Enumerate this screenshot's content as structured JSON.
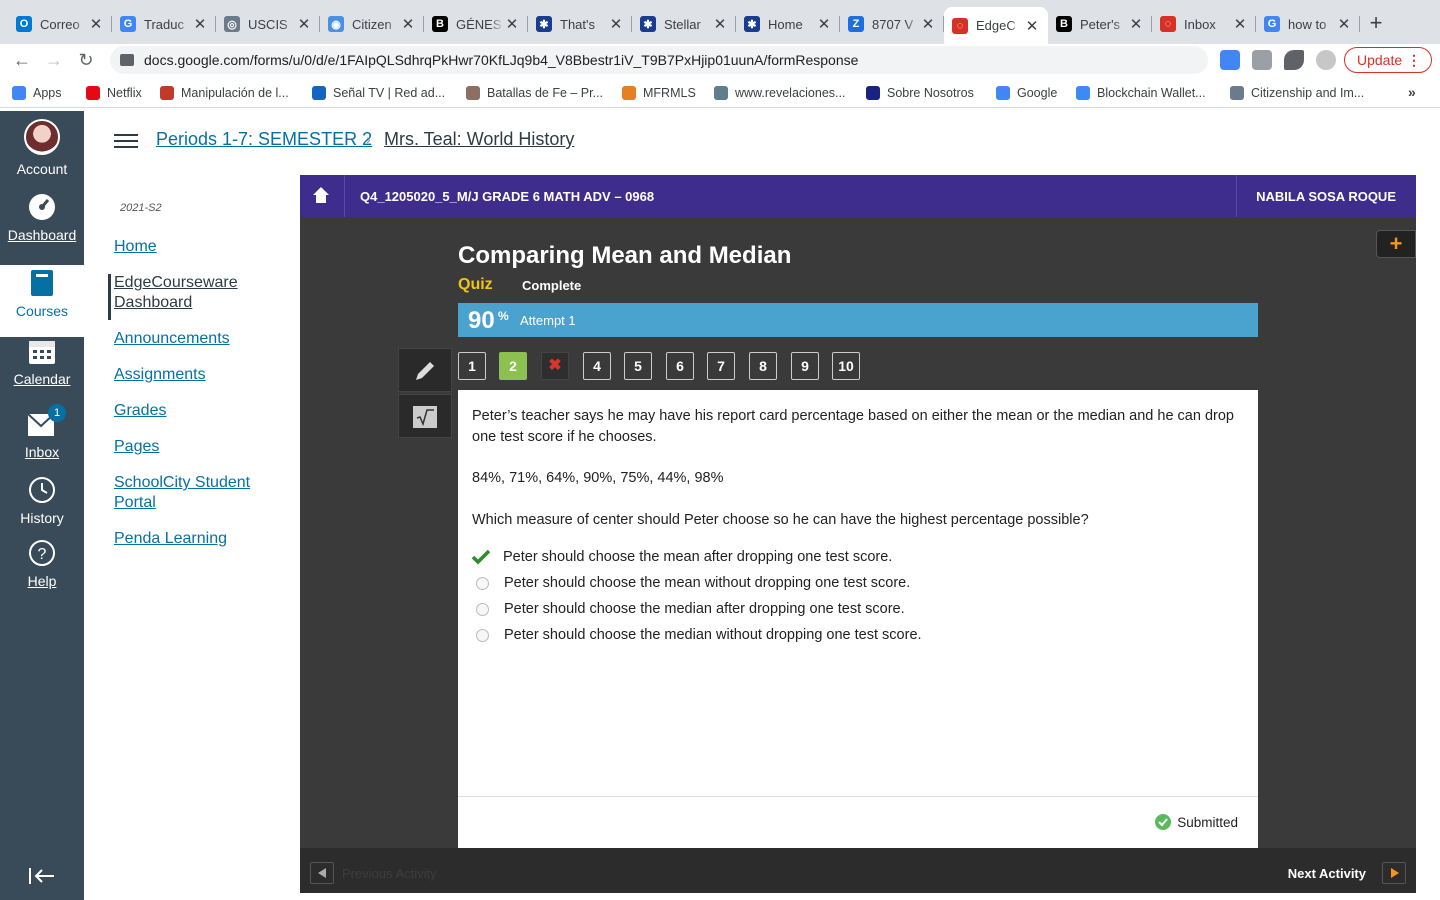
{
  "browser": {
    "tabs": [
      {
        "title": "Correo",
        "color": "#0078d4",
        "glyph": "O"
      },
      {
        "title": "Traduc",
        "color": "#4285f4",
        "glyph": "G"
      },
      {
        "title": "USCIS",
        "color": "#6b7b8c",
        "glyph": "◎"
      },
      {
        "title": "Citizen",
        "color": "#4a90e2",
        "glyph": "◉"
      },
      {
        "title": "GÉNES",
        "color": "#000000",
        "glyph": "B"
      },
      {
        "title": "That's",
        "color": "#1a3c8f",
        "glyph": "✱"
      },
      {
        "title": "Stellar",
        "color": "#1a3c8f",
        "glyph": "✱"
      },
      {
        "title": "Home",
        "color": "#1a3c8f",
        "glyph": "✱"
      },
      {
        "title": "8707 V",
        "color": "#1e6fd9",
        "glyph": "Z"
      },
      {
        "title": "EdgeC",
        "color": "#d93025",
        "glyph": "◌"
      },
      {
        "title": "Peter's",
        "color": "#000000",
        "glyph": "B"
      },
      {
        "title": "Inbox",
        "color": "#d93025",
        "glyph": "◌"
      },
      {
        "title": "how to",
        "color": "#4285f4",
        "glyph": "G"
      }
    ],
    "active_tab_index": 9,
    "url": "docs.google.com/forms/u/0/d/e/1FAIpQLSdhrqPkHwr70KfLJq9b4_V8Bbestr1iV_T9B7PxHjip01uunA/formResponse",
    "update_label": "Update",
    "bookmarks": [
      {
        "label": "Apps",
        "color": "#4285f4"
      },
      {
        "label": "Netflix",
        "color": "#e50914"
      },
      {
        "label": "Manipulación de l...",
        "color": "#c0392b"
      },
      {
        "label": "Señal TV | Red ad...",
        "color": "#1565c0"
      },
      {
        "label": "Batallas de Fe – Pr...",
        "color": "#8d6e63"
      },
      {
        "label": "MFRMLS",
        "color": "#e67e22"
      },
      {
        "label": "www.revelaciones...",
        "color": "#607d8b"
      },
      {
        "label": "Sobre Nosotros",
        "color": "#1a237e"
      },
      {
        "label": "Google",
        "color": "#4285f4"
      },
      {
        "label": "Blockchain Wallet...",
        "color": "#3d89f5"
      },
      {
        "label": "Citizenship and Im...",
        "color": "#6b7b8c"
      }
    ]
  },
  "global_nav": {
    "items": [
      {
        "label": "Account",
        "icon": "avatar"
      },
      {
        "label": "Dashboard",
        "icon": "dashboard-icon"
      },
      {
        "label": "Courses",
        "icon": "courses-icon"
      },
      {
        "label": "Calendar",
        "icon": "calendar-icon"
      },
      {
        "label": "Inbox",
        "icon": "inbox-icon",
        "badge": "1"
      },
      {
        "label": "History",
        "icon": "history-icon"
      },
      {
        "label": "Help",
        "icon": "help-icon"
      }
    ]
  },
  "breadcrumb": {
    "course": "Periods 1-7: SEMESTER 2",
    "page": "Mrs. Teal: World History"
  },
  "course_nav": {
    "term": "2021-S2",
    "items": [
      "Home",
      "EdgeCourseware Dashboard",
      "Announcements",
      "Assignments",
      "Grades",
      "Pages",
      "SchoolCity Student Portal",
      "Penda Learning"
    ]
  },
  "edgenuity": {
    "course_code": "Q4_1205020_5_M/J GRADE 6 MATH ADV – 0968",
    "student_name": "NABILA SOSA ROQUE",
    "lesson_title": "Comparing Mean and Median",
    "activity_type": "Quiz",
    "status": "Complete",
    "score": "90",
    "score_unit": "%",
    "attempt": "Attempt 1",
    "questions": [
      "1",
      "2",
      "✖",
      "4",
      "5",
      "6",
      "7",
      "8",
      "9",
      "10"
    ],
    "question_body": "Peter’s teacher says he may have his report card percentage based on either the mean or the median and he can drop one test score if he chooses.",
    "scores_list": "84%, 71%, 64%, 90%, 75%, 44%, 98%",
    "prompt": "Which measure of center should Peter choose so he can have the highest percentage possible?",
    "options": [
      "Peter should choose the mean after dropping one test score.",
      "Peter should choose the mean without dropping one test score.",
      "Peter should choose the median after dropping one test score.",
      "Peter should choose the median without dropping one test score."
    ],
    "submitted_label": "Submitted",
    "prev_label": "Previous Activity",
    "next_label": "Next Activity"
  }
}
